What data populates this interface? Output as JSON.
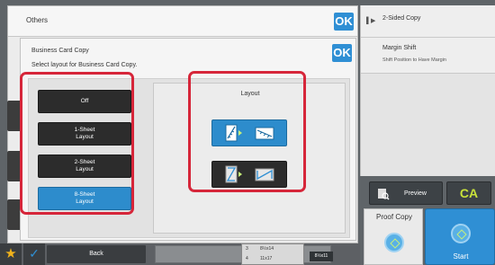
{
  "others_panel": {
    "title": "Others",
    "ok_label": "OK"
  },
  "dialog": {
    "title": "Business Card Copy",
    "instruction": "Select layout for Business Card Copy.",
    "ok_label": "OK",
    "options": [
      {
        "line1": "Off",
        "line2": ""
      },
      {
        "line1": "1-Sheet",
        "line2": "Layout"
      },
      {
        "line1": "2-Sheet",
        "line2": "Layout"
      },
      {
        "line1": "8-Sheet",
        "line2": "Layout",
        "selected": true
      }
    ],
    "layout_label": "Layout"
  },
  "right_panel": {
    "items": [
      {
        "title": "2-Sided Copy",
        "subtitle": ""
      },
      {
        "title": "Margin Shift",
        "subtitle": "Shift Position to Have Margin"
      }
    ],
    "preview_label": "Preview",
    "ca_label": "CA",
    "proof_copy_label": "Proof Copy",
    "start_label": "Start"
  },
  "bottom_bar": {
    "back_label": "Back",
    "paper_lines": [
      "3",
      "4",
      "8½x14",
      "11x17"
    ],
    "paper_size": "8½x11"
  },
  "colors": {
    "accent": "#2f8fd4",
    "highlight": "#d6263a",
    "ca": "#c9e23a"
  },
  "icons": [
    "star-icon",
    "check-icon",
    "expand-arrow-icon",
    "preview-icon",
    "diamond-start-icon"
  ]
}
